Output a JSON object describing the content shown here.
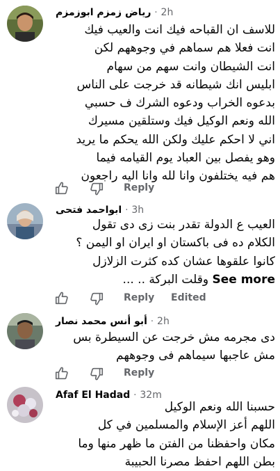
{
  "comments": [
    {
      "author": "رياض زمزم ابوزمزم",
      "time": "2h",
      "lines": [
        "للاسف ان القباحه فيك انت والعيب فيك",
        "انت فعلا هم سماهم في وجوههم لكن",
        "انت الشيطان وانت سهم من سهام",
        "ابليس انك شيطانه قد خرجت على الناس",
        "بدعوه الخراب ودعوه الشرك ف حسبي",
        "الله ونعم الوكيل فيك وستلقين مسيرك",
        "اني لا احكم عليك ولكن الله يحكم ما يريد",
        "وهو يفصل بين العباد يوم القيامه فيما",
        "هم فيه يختلفون وانا لله وانا اليه راجعون"
      ],
      "reply_label": "Reply"
    },
    {
      "author": "ابواحمد فتحى",
      "time": "3h",
      "lines": [
        "العيب ع الدولة تقدر بنت زى دى تقول",
        "الكلام ده فى باكستان او ايران او اليمن ؟",
        "كانوا علقوها عشان كده كثرت الزلازل",
        "وقلت البركة .. ..."
      ],
      "see_more": "See more",
      "reply_label": "Reply",
      "edited_label": "Edited"
    },
    {
      "author": "أبو أنس محمد نصار",
      "time": "2h",
      "lines": [
        "دى مجرمه مش خرجت عن السيطرة بس",
        "مش عاجبها سيماهم فى وجوههم"
      ],
      "reply_label": "Reply"
    },
    {
      "author": "Afaf El Hadad",
      "time": "32m",
      "lines": [
        "حسبنا الله ونعم الوكيل",
        "اللهم أعز الإسلام والمسلمين في كل",
        "مكان واحفظنا من الفتن ما ظهر منها وما",
        "بطن اللهم احفظ مصرنا الحبيبة"
      ]
    }
  ],
  "separator": "·",
  "icons": {
    "like": "thumbs-up-icon",
    "dislike": "thumbs-down-icon"
  },
  "colors": {
    "meta_gray": "#65676b",
    "text": "#050505"
  }
}
